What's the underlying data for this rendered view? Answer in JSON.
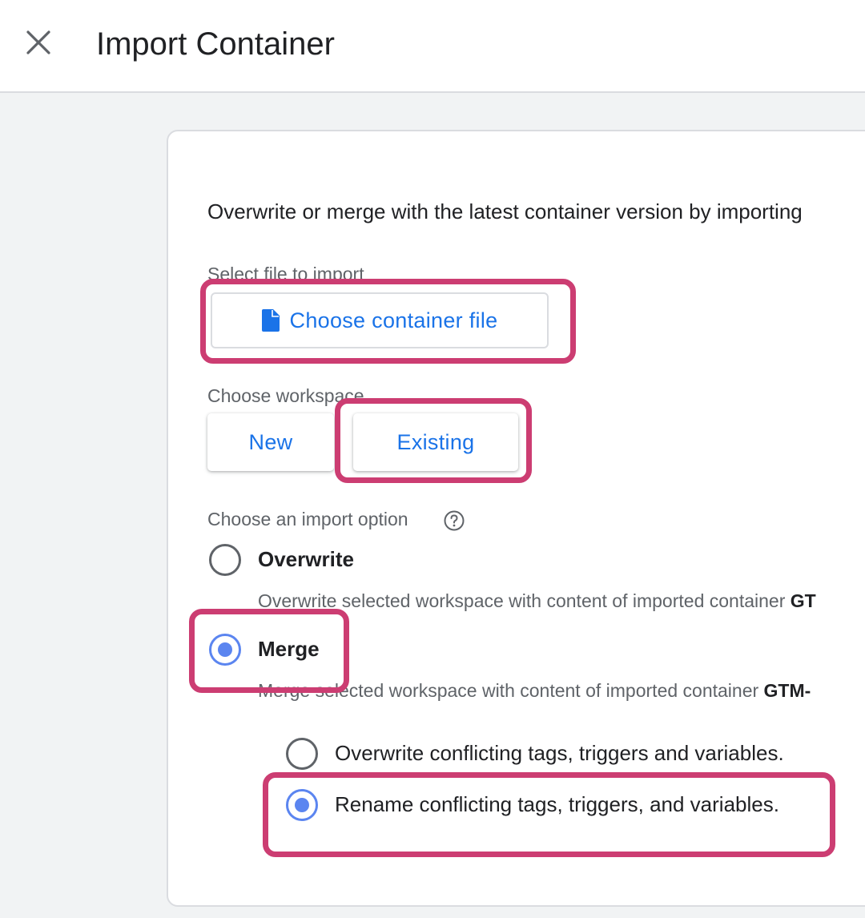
{
  "header": {
    "title": "Import Container"
  },
  "card": {
    "intro": "Overwrite or merge with the latest container version by importing",
    "file_section": {
      "label": "Select file to import",
      "button_label": "Choose container file"
    },
    "workspace_section": {
      "label": "Choose workspace",
      "new_label": "New",
      "existing_label": "Existing"
    },
    "import_section": {
      "label": "Choose an import option",
      "overwrite": {
        "label": "Overwrite",
        "description": "Overwrite selected workspace with content of imported container",
        "description_bold": "GT"
      },
      "merge": {
        "label": "Merge",
        "description": "Merge selected workspace with content of imported container",
        "description_bold": "GTM-"
      },
      "conflict_options": [
        {
          "label": "Overwrite conflicting tags, triggers and variables."
        },
        {
          "label": "Rename conflicting tags, triggers, and variables."
        }
      ],
      "selected_option": "Merge",
      "selected_conflict_option": "Rename conflicting tags, triggers, and variables."
    }
  },
  "colors": {
    "accent": "#1a73e8",
    "radio": "#5b85f0",
    "highlight": "#cc3d72"
  },
  "icons": [
    "close-icon",
    "file-icon",
    "help-icon"
  ]
}
